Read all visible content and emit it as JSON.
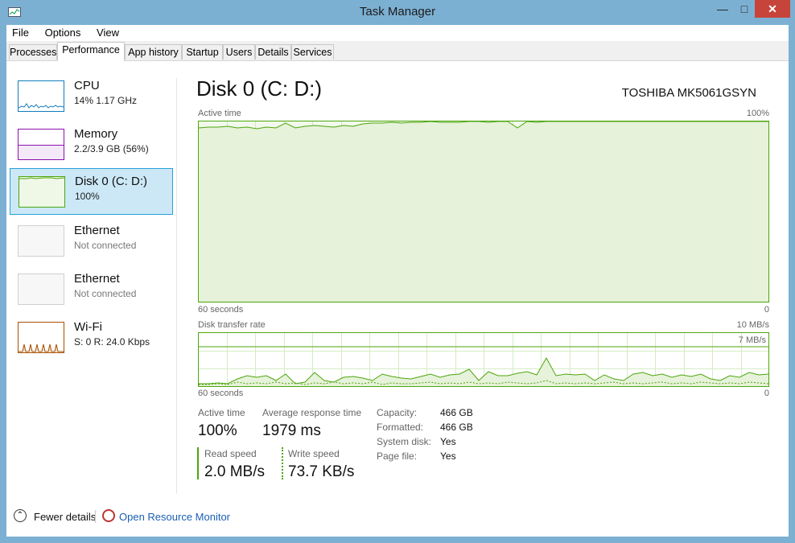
{
  "window": {
    "title": "Task Manager"
  },
  "window_buttons": {
    "minimize": "—",
    "maximize": "□",
    "close": "✕"
  },
  "menu": [
    "File",
    "Options",
    "View"
  ],
  "tabs": [
    "Processes",
    "Performance",
    "App history",
    "Startup",
    "Users",
    "Details",
    "Services"
  ],
  "active_tab": "Performance",
  "sidebar": [
    {
      "name": "CPU",
      "detail": "14%  1.17 GHz"
    },
    {
      "name": "Memory",
      "detail": "2.2/3.9 GB (56%)"
    },
    {
      "name": "Disk 0 (C: D:)",
      "detail": "100%"
    },
    {
      "name": "Ethernet",
      "detail": "Not connected"
    },
    {
      "name": "Ethernet",
      "detail": "Not connected"
    },
    {
      "name": "Wi-Fi",
      "detail": "S: 0  R: 24.0 Kbps"
    }
  ],
  "main": {
    "title": "Disk 0 (C: D:)",
    "model": "TOSHIBA MK5061GSYN",
    "active_chart": {
      "label": "Active time",
      "max": "100%",
      "x_left": "60 seconds",
      "x_right": "0"
    },
    "transfer_chart": {
      "label": "Disk transfer rate",
      "max": "10 MB/s",
      "line_label": "7 MB/s",
      "x_left": "60 seconds",
      "x_right": "0"
    },
    "stats": {
      "active_time_label": "Active time",
      "active_time": "100%",
      "response_label": "Average response time",
      "response": "1979 ms",
      "read_label": "Read speed",
      "read": "2.0 MB/s",
      "write_label": "Write speed",
      "write": "73.7 KB/s"
    },
    "info": [
      {
        "label": "Capacity:",
        "value": "466 GB"
      },
      {
        "label": "Formatted:",
        "value": "466 GB"
      },
      {
        "label": "System disk:",
        "value": "Yes"
      },
      {
        "label": "Page file:",
        "value": "Yes"
      }
    ]
  },
  "footer": {
    "fewer_details": "Fewer details",
    "resource_monitor": "Open Resource Monitor"
  },
  "colors": {
    "disk": "#4da60c",
    "cpu": "#117dbb",
    "memory": "#8b12ae",
    "wifi": "#a74f01",
    "selection": "#cce8f7"
  }
}
